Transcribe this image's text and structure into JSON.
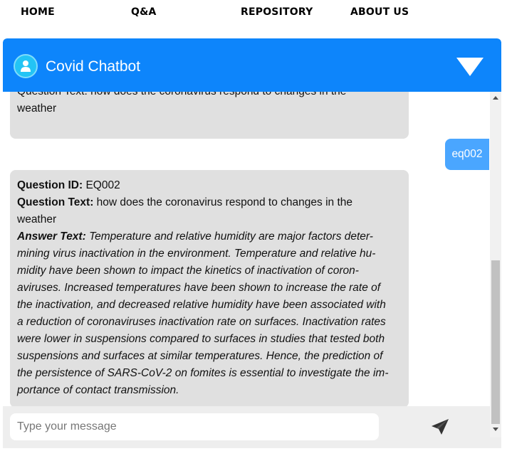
{
  "nav": {
    "home": "HOME",
    "qa": "Q&A",
    "repository": "REPOSITORY",
    "about": "ABOUT US"
  },
  "chat": {
    "title": "Covid Chatbot",
    "accent_color": "#0d85fb",
    "avatar_icon": "user-icon",
    "toggle_icon": "triangle-down-icon",
    "send_icon": "paper-plane-icon"
  },
  "messages": {
    "previous_bot": {
      "partial_line": "Question Text: how does the coronavirus respond to changes in the",
      "last_line": "weather"
    },
    "user": {
      "text": "eq002"
    },
    "bot": {
      "id_label": "Question ID:",
      "id_value": "EQ002",
      "question_label": "Question Text:",
      "question_line1": "how does the coronavirus respond to changes in the",
      "question_line2": "weather",
      "answer_label": "Answer Text:",
      "answer_lines": [
        "Temperature and relative humidity are major factors deter-",
        "mining virus inactivation in the environment. Temperature and relative hu-",
        "midity have been shown to impact the kinetics of inactivation of coron-",
        "aviruses. Increased temperatures have been shown to increase the rate of",
        "the inactivation, and decreased relative humidity have been associated with",
        "a reduction of coronaviruses inactivation rate on surfaces. Inactivation rates",
        "were lower in suspensions compared to surfaces in studies that tested both",
        "suspensions and surfaces at similar temperatures. Hence, the prediction of",
        "the persistence of SARS-CoV-2 on fomites is essential to investigate the im-",
        "portance of contact transmission."
      ]
    }
  },
  "input": {
    "placeholder": "Type your message",
    "value": ""
  }
}
